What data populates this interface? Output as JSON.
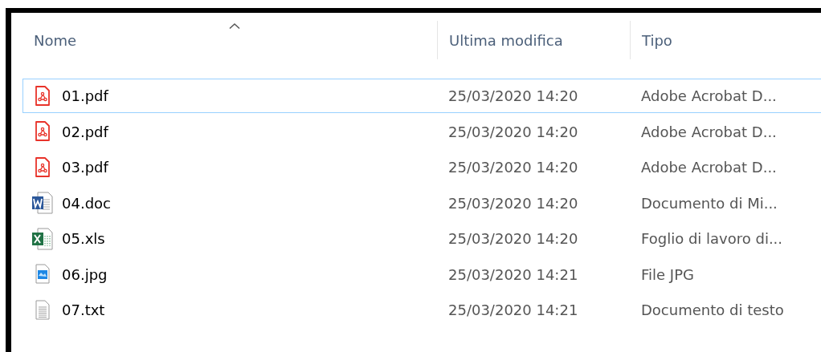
{
  "table": {
    "columns": [
      {
        "label": "Nome",
        "sorted": true
      },
      {
        "label": "Ultima modifica",
        "sorted": false
      },
      {
        "label": "Tipo",
        "sorted": false
      }
    ],
    "rows": [
      {
        "kind": "pdf",
        "name": "01.pdf",
        "modified": "25/03/2020 14:20",
        "type": "Adobe Acrobat D...",
        "selected": true
      },
      {
        "kind": "pdf",
        "name": "02.pdf",
        "modified": "25/03/2020 14:20",
        "type": "Adobe Acrobat D...",
        "selected": false
      },
      {
        "kind": "pdf",
        "name": "03.pdf",
        "modified": "25/03/2020 14:20",
        "type": "Adobe Acrobat D...",
        "selected": false
      },
      {
        "kind": "doc",
        "name": "04.doc",
        "modified": "25/03/2020 14:20",
        "type": "Documento di Mi...",
        "selected": false
      },
      {
        "kind": "xls",
        "name": "05.xls",
        "modified": "25/03/2020 14:20",
        "type": "Foglio di lavoro di...",
        "selected": false
      },
      {
        "kind": "jpg",
        "name": "06.jpg",
        "modified": "25/03/2020 14:21",
        "type": "File JPG",
        "selected": false
      },
      {
        "kind": "txt",
        "name": "07.txt",
        "modified": "25/03/2020 14:21",
        "type": "Documento di testo",
        "selected": false
      }
    ]
  }
}
